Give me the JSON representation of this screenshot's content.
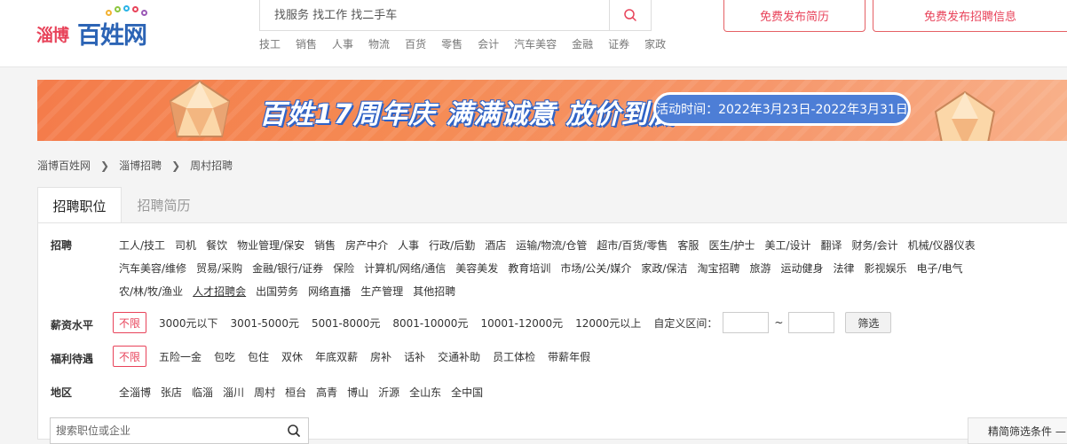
{
  "header": {
    "logo_city": "淄博",
    "logo_brand": "百姓网",
    "search_placeholder": "找服务 找工作 找二手车",
    "hot_links": [
      "技工",
      "销售",
      "人事",
      "物流",
      "百货",
      "零售",
      "会计",
      "汽车美容",
      "金融",
      "证券",
      "家政"
    ],
    "post_resume_label": "免费发布简历",
    "post_job_label": "免费发布招聘信息"
  },
  "banner": {
    "title": "百姓17周年庆 满满诚意 放价到底",
    "date_text": "活动时间：2022年3月23日-2022年3月31日"
  },
  "breadcrumb": {
    "items": [
      "淄博百姓网",
      "淄博招聘",
      "周村招聘"
    ]
  },
  "tabs": {
    "active": "招聘职位",
    "inactive": "招聘简历"
  },
  "filters": {
    "category_label": "招聘",
    "category_rows": [
      [
        "工人/技工",
        "司机",
        "餐饮",
        "物业管理/保安",
        "销售",
        "房产中介",
        "人事",
        "行政/后勤",
        "酒店",
        "运输/物流/仓管",
        "超市/百货/零售",
        "客服",
        "医生/护士",
        "美工/设计",
        "翻译",
        "财务/会计",
        "机械/仪器仪表"
      ],
      [
        "汽车美容/维修",
        "贸易/采购",
        "金融/银行/证券",
        "保险",
        "计算机/网络/通信",
        "美容美发",
        "教育培训",
        "市场/公关/媒介",
        "家政/保洁",
        "淘宝招聘",
        "旅游",
        "运动健身",
        "法律",
        "影视娱乐",
        "电子/电气"
      ],
      [
        "农/林/牧/渔业",
        "人才招聘会",
        "出国劳务",
        "网络直播",
        "生产管理",
        "其他招聘"
      ]
    ],
    "salary_label": "薪资水平",
    "unlimited_label": "不限",
    "salary_options": [
      "3000元以下",
      "3001-5000元",
      "5001-8000元",
      "8001-10000元",
      "10001-12000元",
      "12000元以上"
    ],
    "custom_range_label": "自定义区间：",
    "range_separator": "~",
    "filter_button": "筛选",
    "welfare_label": "福利待遇",
    "welfare_options": [
      "五险一金",
      "包吃",
      "包住",
      "双休",
      "年底双薪",
      "房补",
      "话补",
      "交通补助",
      "员工体检",
      "带薪年假"
    ],
    "region_label": "地区",
    "region_options": [
      "全淄博",
      "张店",
      "临淄",
      "淄川",
      "周村",
      "桓台",
      "高青",
      "博山",
      "沂源",
      "全山东",
      "全中国"
    ],
    "position_search_placeholder": "搜索职位或企业",
    "simple_filter_label": "精简筛选条件 —"
  },
  "colors": {
    "accent_red": "#e8435a",
    "brand_blue": "#2c64b5",
    "banner_orange": "#f47c4b"
  }
}
